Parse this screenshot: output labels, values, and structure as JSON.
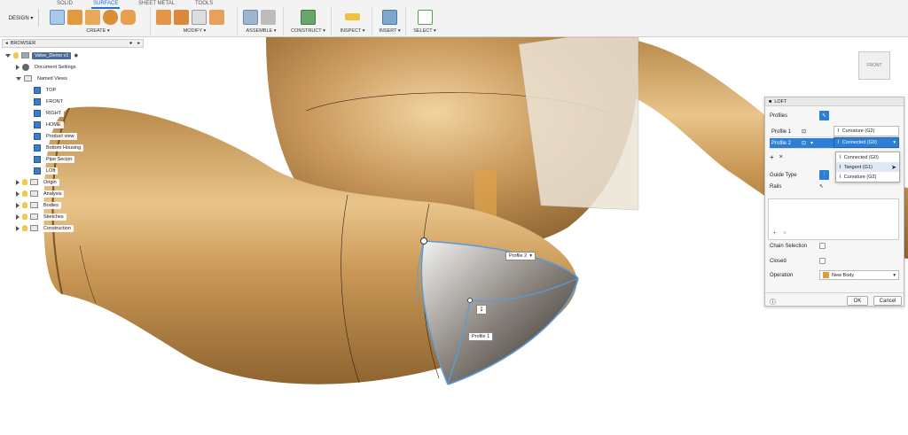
{
  "toolbar": {
    "design_label": "DESIGN ▾",
    "tabs": [
      "SOLID",
      "SURFACE",
      "SHEET METAL",
      "TOOLS"
    ],
    "groups": {
      "create": "CREATE ▾",
      "modify": "MODIFY ▾",
      "assemble": "ASSEMBLE ▾",
      "construct": "CONSTRUCT ▾",
      "inspect": "INSPECT ▾",
      "insert": "INSERT ▾",
      "select": "SELECT ▾"
    }
  },
  "browser": {
    "title": "BROWSER",
    "document": "Valve_Demo v1",
    "doc_settings": "Document Settings",
    "named_views": "Named Views",
    "views": [
      "TOP",
      "FRONT",
      "RIGHT",
      "HOME",
      "Product view",
      "Bottom Housing",
      "Pipe Secion",
      "LOft"
    ],
    "folders": [
      "Origin",
      "Analysis",
      "Bodies",
      "Sketches",
      "Construction"
    ]
  },
  "viewcube": {
    "face": "FRONT"
  },
  "canvas": {
    "profile2_label": "Profile 2",
    "profile1_label": "Profile 1"
  },
  "loft": {
    "title": "LOFT",
    "profiles_label": "Profiles",
    "profile1": {
      "name": "Profile 1",
      "condition": "Curvature (G2)"
    },
    "profile2": {
      "name": "Profile 2",
      "condition": "Connected (G0)"
    },
    "dropdown_options": [
      "Connected (G0)",
      "Tangent (G1)",
      "Curvature (G2)"
    ],
    "guide_type_label": "Guide Type",
    "rails_label": "Rails",
    "chain_selection_label": "Chain Selection",
    "closed_label": "Closed",
    "operation_label": "Operation",
    "operation_value": "New Body",
    "ok": "OK",
    "cancel": "Cancel"
  }
}
